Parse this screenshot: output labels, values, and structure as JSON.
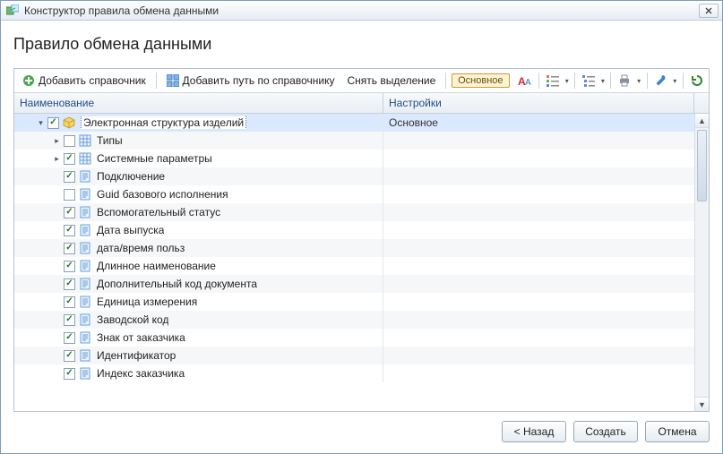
{
  "window": {
    "title": "Конструктор правила обмена данными"
  },
  "page": {
    "heading": "Правило обмена данными"
  },
  "toolbar": {
    "add_ref": "Добавить справочник",
    "add_path": "Добавить путь по справочнику",
    "deselect": "Снять выделение",
    "main_badge": "Основное"
  },
  "columns": {
    "name": "Наименование",
    "settings": "Настройки"
  },
  "tree": {
    "root": {
      "label": "Электронная структура изделий",
      "settings": "Основное",
      "checked": true,
      "expanded": true,
      "selected": true
    },
    "children": [
      {
        "label": "Типы",
        "checked": false,
        "hasChildren": true,
        "icon": "grid"
      },
      {
        "label": "Системные параметры",
        "checked": true,
        "hasChildren": true,
        "icon": "grid"
      },
      {
        "label": "Подключение",
        "checked": true,
        "hasChildren": false,
        "icon": "doc"
      },
      {
        "label": "Guid базового исполнения",
        "checked": false,
        "hasChildren": false,
        "icon": "doc"
      },
      {
        "label": "Вспомогательный статус",
        "checked": true,
        "hasChildren": false,
        "icon": "doc"
      },
      {
        "label": "Дата выпуска",
        "checked": true,
        "hasChildren": false,
        "icon": "doc"
      },
      {
        "label": "дата/время польз",
        "checked": true,
        "hasChildren": false,
        "icon": "doc"
      },
      {
        "label": "Длинное наименование",
        "checked": true,
        "hasChildren": false,
        "icon": "doc"
      },
      {
        "label": "Дополнительный код документа",
        "checked": true,
        "hasChildren": false,
        "icon": "doc"
      },
      {
        "label": "Единица измерения",
        "checked": true,
        "hasChildren": false,
        "icon": "doc"
      },
      {
        "label": "Заводской код",
        "checked": true,
        "hasChildren": false,
        "icon": "doc"
      },
      {
        "label": "Знак от заказчика",
        "checked": true,
        "hasChildren": false,
        "icon": "doc"
      },
      {
        "label": "Идентификатор",
        "checked": true,
        "hasChildren": false,
        "icon": "doc"
      },
      {
        "label": "Индекс заказчика",
        "checked": true,
        "hasChildren": false,
        "icon": "doc"
      }
    ]
  },
  "footer": {
    "back": "< Назад",
    "create": "Создать",
    "cancel": "Отмена"
  }
}
